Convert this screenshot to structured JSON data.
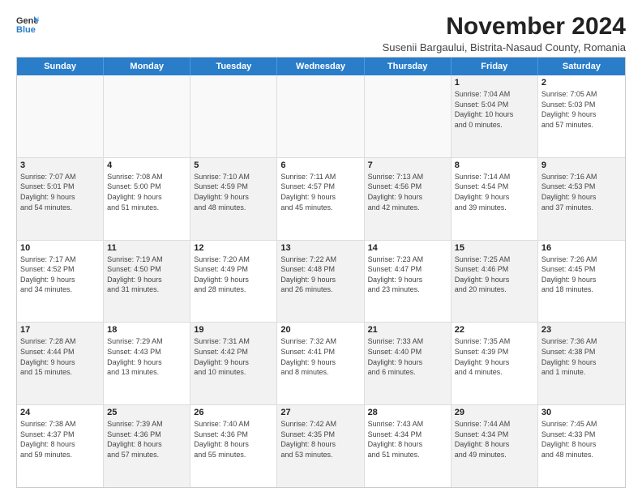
{
  "logo": {
    "line1": "General",
    "line2": "Blue"
  },
  "title": "November 2024",
  "subtitle": "Susenii Bargaului, Bistrita-Nasaud County, Romania",
  "days_of_week": [
    "Sunday",
    "Monday",
    "Tuesday",
    "Wednesday",
    "Thursday",
    "Friday",
    "Saturday"
  ],
  "weeks": [
    [
      {
        "num": "",
        "detail": "",
        "empty": true
      },
      {
        "num": "",
        "detail": "",
        "empty": true
      },
      {
        "num": "",
        "detail": "",
        "empty": true
      },
      {
        "num": "",
        "detail": "",
        "empty": true
      },
      {
        "num": "",
        "detail": "",
        "empty": true
      },
      {
        "num": "1",
        "detail": "Sunrise: 7:04 AM\nSunset: 5:04 PM\nDaylight: 10 hours\nand 0 minutes.",
        "shaded": true
      },
      {
        "num": "2",
        "detail": "Sunrise: 7:05 AM\nSunset: 5:03 PM\nDaylight: 9 hours\nand 57 minutes.",
        "shaded": false
      }
    ],
    [
      {
        "num": "3",
        "detail": "Sunrise: 7:07 AM\nSunset: 5:01 PM\nDaylight: 9 hours\nand 54 minutes.",
        "shaded": true
      },
      {
        "num": "4",
        "detail": "Sunrise: 7:08 AM\nSunset: 5:00 PM\nDaylight: 9 hours\nand 51 minutes.",
        "shaded": false
      },
      {
        "num": "5",
        "detail": "Sunrise: 7:10 AM\nSunset: 4:59 PM\nDaylight: 9 hours\nand 48 minutes.",
        "shaded": true
      },
      {
        "num": "6",
        "detail": "Sunrise: 7:11 AM\nSunset: 4:57 PM\nDaylight: 9 hours\nand 45 minutes.",
        "shaded": false
      },
      {
        "num": "7",
        "detail": "Sunrise: 7:13 AM\nSunset: 4:56 PM\nDaylight: 9 hours\nand 42 minutes.",
        "shaded": true
      },
      {
        "num": "8",
        "detail": "Sunrise: 7:14 AM\nSunset: 4:54 PM\nDaylight: 9 hours\nand 39 minutes.",
        "shaded": false
      },
      {
        "num": "9",
        "detail": "Sunrise: 7:16 AM\nSunset: 4:53 PM\nDaylight: 9 hours\nand 37 minutes.",
        "shaded": true
      }
    ],
    [
      {
        "num": "10",
        "detail": "Sunrise: 7:17 AM\nSunset: 4:52 PM\nDaylight: 9 hours\nand 34 minutes.",
        "shaded": false
      },
      {
        "num": "11",
        "detail": "Sunrise: 7:19 AM\nSunset: 4:50 PM\nDaylight: 9 hours\nand 31 minutes.",
        "shaded": true
      },
      {
        "num": "12",
        "detail": "Sunrise: 7:20 AM\nSunset: 4:49 PM\nDaylight: 9 hours\nand 28 minutes.",
        "shaded": false
      },
      {
        "num": "13",
        "detail": "Sunrise: 7:22 AM\nSunset: 4:48 PM\nDaylight: 9 hours\nand 26 minutes.",
        "shaded": true
      },
      {
        "num": "14",
        "detail": "Sunrise: 7:23 AM\nSunset: 4:47 PM\nDaylight: 9 hours\nand 23 minutes.",
        "shaded": false
      },
      {
        "num": "15",
        "detail": "Sunrise: 7:25 AM\nSunset: 4:46 PM\nDaylight: 9 hours\nand 20 minutes.",
        "shaded": true
      },
      {
        "num": "16",
        "detail": "Sunrise: 7:26 AM\nSunset: 4:45 PM\nDaylight: 9 hours\nand 18 minutes.",
        "shaded": false
      }
    ],
    [
      {
        "num": "17",
        "detail": "Sunrise: 7:28 AM\nSunset: 4:44 PM\nDaylight: 9 hours\nand 15 minutes.",
        "shaded": true
      },
      {
        "num": "18",
        "detail": "Sunrise: 7:29 AM\nSunset: 4:43 PM\nDaylight: 9 hours\nand 13 minutes.",
        "shaded": false
      },
      {
        "num": "19",
        "detail": "Sunrise: 7:31 AM\nSunset: 4:42 PM\nDaylight: 9 hours\nand 10 minutes.",
        "shaded": true
      },
      {
        "num": "20",
        "detail": "Sunrise: 7:32 AM\nSunset: 4:41 PM\nDaylight: 9 hours\nand 8 minutes.",
        "shaded": false
      },
      {
        "num": "21",
        "detail": "Sunrise: 7:33 AM\nSunset: 4:40 PM\nDaylight: 9 hours\nand 6 minutes.",
        "shaded": true
      },
      {
        "num": "22",
        "detail": "Sunrise: 7:35 AM\nSunset: 4:39 PM\nDaylight: 9 hours\nand 4 minutes.",
        "shaded": false
      },
      {
        "num": "23",
        "detail": "Sunrise: 7:36 AM\nSunset: 4:38 PM\nDaylight: 9 hours\nand 1 minute.",
        "shaded": true
      }
    ],
    [
      {
        "num": "24",
        "detail": "Sunrise: 7:38 AM\nSunset: 4:37 PM\nDaylight: 8 hours\nand 59 minutes.",
        "shaded": false
      },
      {
        "num": "25",
        "detail": "Sunrise: 7:39 AM\nSunset: 4:36 PM\nDaylight: 8 hours\nand 57 minutes.",
        "shaded": true
      },
      {
        "num": "26",
        "detail": "Sunrise: 7:40 AM\nSunset: 4:36 PM\nDaylight: 8 hours\nand 55 minutes.",
        "shaded": false
      },
      {
        "num": "27",
        "detail": "Sunrise: 7:42 AM\nSunset: 4:35 PM\nDaylight: 8 hours\nand 53 minutes.",
        "shaded": true
      },
      {
        "num": "28",
        "detail": "Sunrise: 7:43 AM\nSunset: 4:34 PM\nDaylight: 8 hours\nand 51 minutes.",
        "shaded": false
      },
      {
        "num": "29",
        "detail": "Sunrise: 7:44 AM\nSunset: 4:34 PM\nDaylight: 8 hours\nand 49 minutes.",
        "shaded": true
      },
      {
        "num": "30",
        "detail": "Sunrise: 7:45 AM\nSunset: 4:33 PM\nDaylight: 8 hours\nand 48 minutes.",
        "shaded": false
      }
    ]
  ]
}
